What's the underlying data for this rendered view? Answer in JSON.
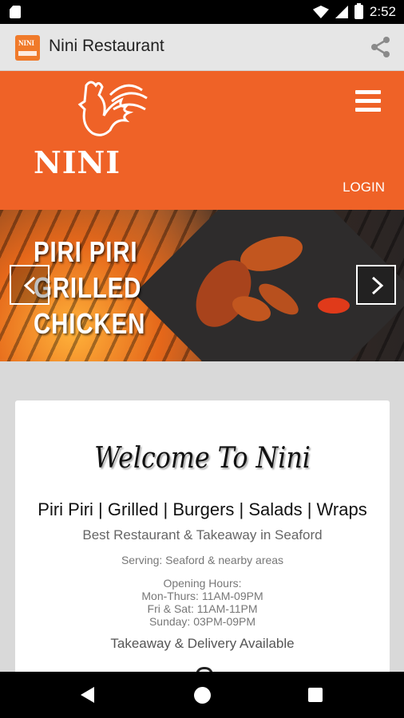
{
  "status_bar": {
    "time": "2:52"
  },
  "app_bar": {
    "icon_text": "NINI",
    "title": "Nini Restaurant"
  },
  "header": {
    "logo_text": "NINI",
    "login_label": "LOGIN"
  },
  "banner": {
    "title_lines": [
      "PIRI PIRI",
      "GRILLED",
      "CHICKEN"
    ]
  },
  "welcome": {
    "heading": "Welcome To Nini",
    "categories": "Piri Piri | Grilled | Burgers | Salads | Wraps",
    "tagline": "Best Restaurant & Takeaway in Seaford",
    "serving": "Serving: Seaford & nearby areas",
    "hours_title": "Opening Hours:",
    "hours": [
      "Mon-Thurs: 11AM-09PM",
      "Fri & Sat: 11AM-11PM",
      "Sunday: 03PM-09PM"
    ],
    "delivery": "Takeaway & Delivery Available"
  },
  "colors": {
    "brand": "#ef6227",
    "appbar": "#e6e6e6",
    "background": "#d9d9d9"
  }
}
